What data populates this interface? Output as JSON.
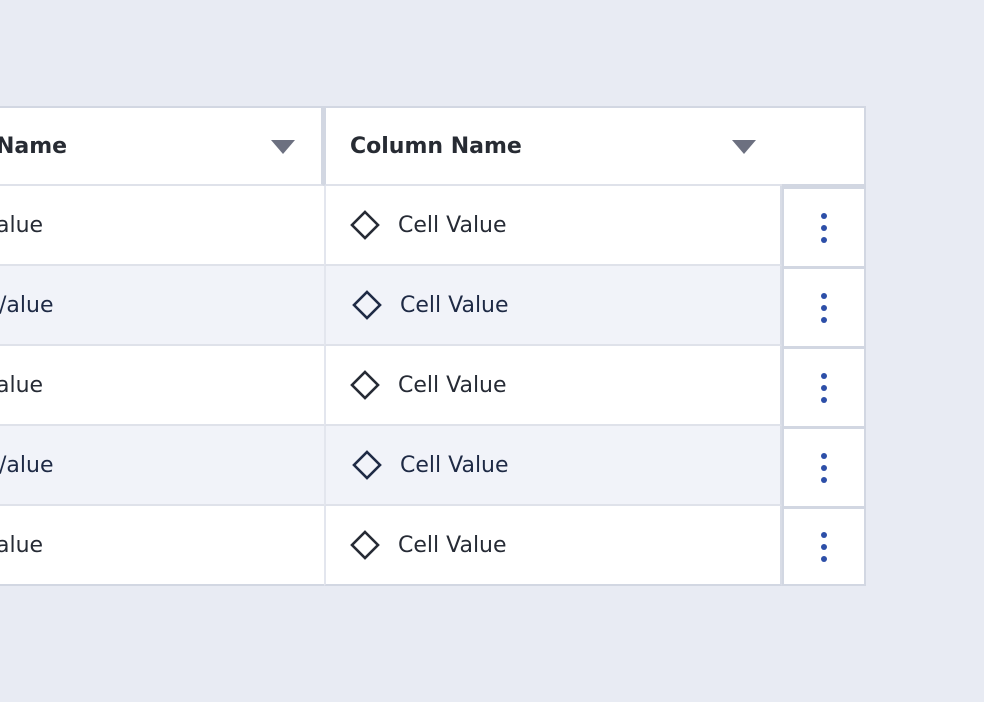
{
  "table": {
    "headers": [
      "Name",
      "Column Name",
      ""
    ],
    "rows": [
      {
        "col1": "alue",
        "col2": "Cell Value"
      },
      {
        "col1": "/alue",
        "col2": "Cell Value"
      },
      {
        "col1": "alue",
        "col2": "Cell Value"
      },
      {
        "col1": "/alue",
        "col2": "Cell Value"
      },
      {
        "col1": "alue",
        "col2": "Cell Value"
      }
    ]
  },
  "icons": {
    "cell_icon": "diamond-icon",
    "row_menu_icon": "kebab-menu-icon",
    "sort_icon": "caret-down-icon"
  },
  "colors": {
    "background": "#e8ebf3",
    "row_alt": "#f1f3f9",
    "kebab": "#2d4fa8",
    "caret": "#6c7080"
  }
}
